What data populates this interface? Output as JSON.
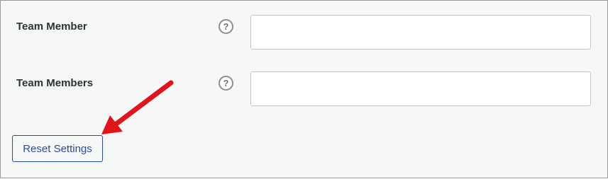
{
  "settings": {
    "rows": [
      {
        "label": "Team Member",
        "help_glyph": "?",
        "value": ""
      },
      {
        "label": "Team Members",
        "help_glyph": "?",
        "value": ""
      }
    ],
    "reset_label": "Reset Settings"
  },
  "annotation": {
    "arrow_color": "#e0141c"
  },
  "colors": {
    "button_accent": "#2c4b9e",
    "background": "#f6f7f7"
  }
}
